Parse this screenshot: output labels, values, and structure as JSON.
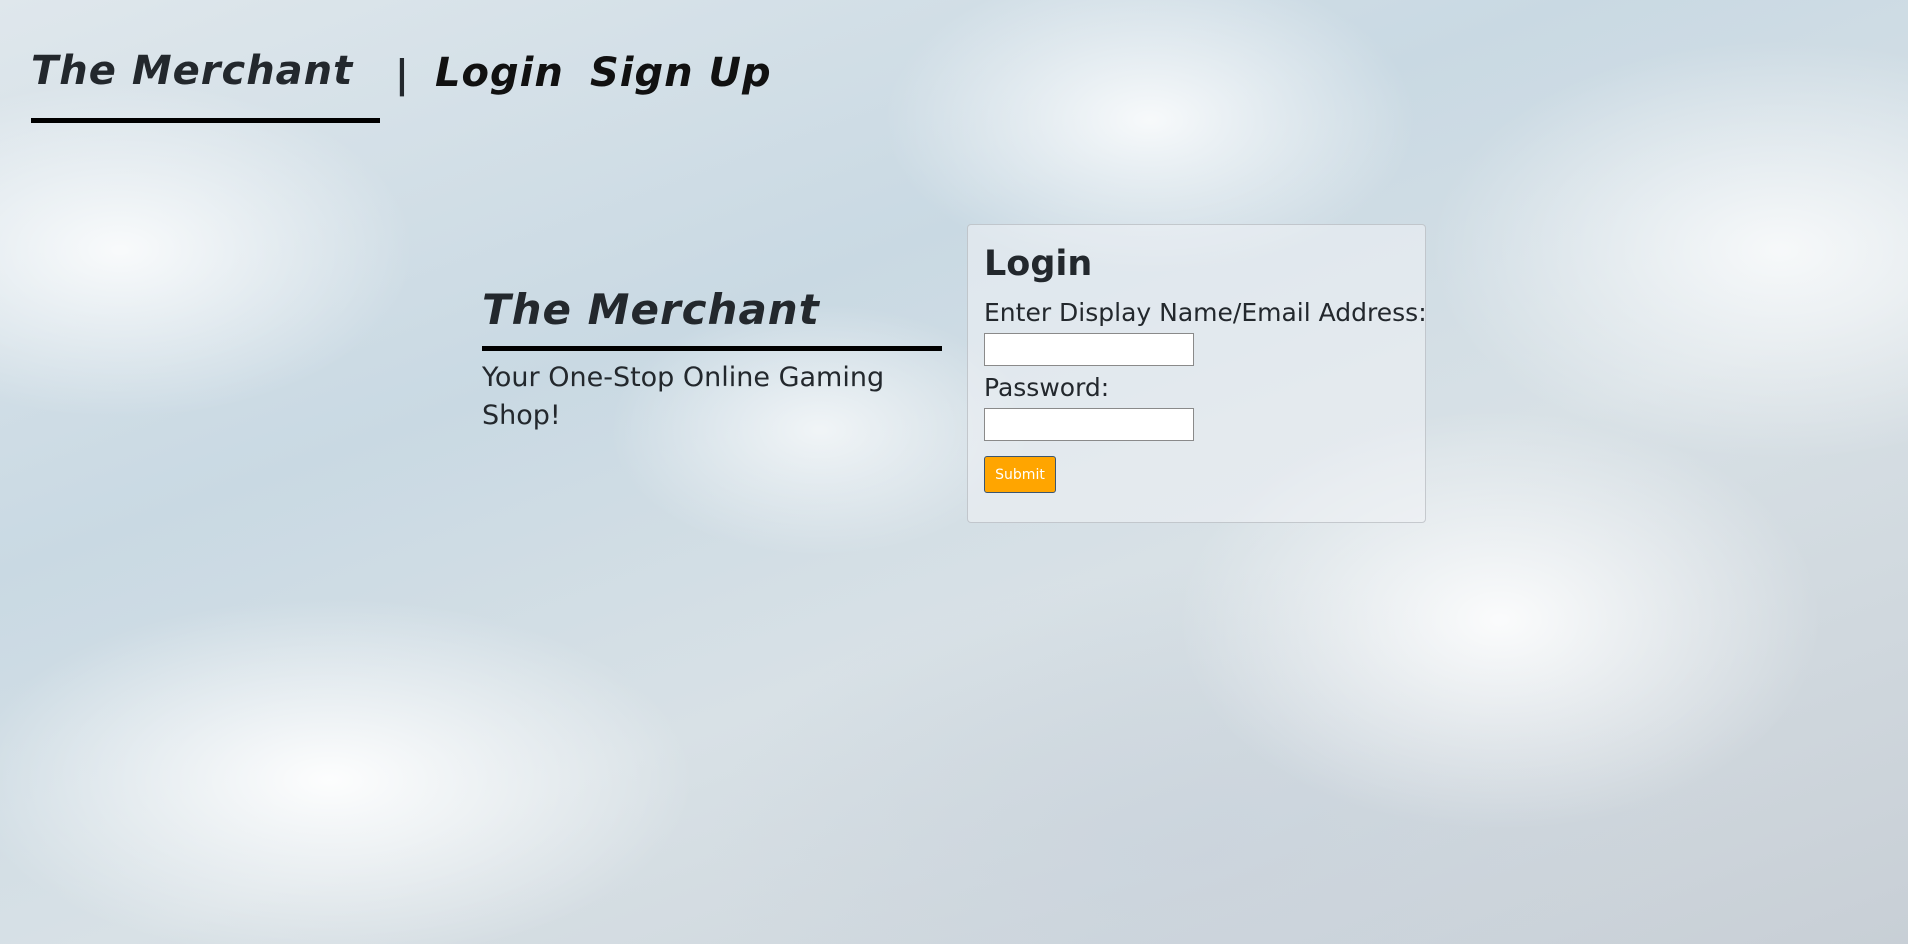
{
  "header": {
    "brand": "The Merchant",
    "separator": "|",
    "nav": {
      "login": "Login",
      "signup": "Sign Up"
    }
  },
  "hero": {
    "title": "The Merchant",
    "tagline": "Your One-Stop Online Gaming Shop!"
  },
  "login_form": {
    "title": "Login",
    "username_label": "Enter Display Name/Email Address:",
    "username_value": "",
    "password_label": "Password:",
    "password_value": "",
    "submit_label": "Submit"
  },
  "colors": {
    "submit_button": "#ffa500",
    "text": "#23282d"
  }
}
